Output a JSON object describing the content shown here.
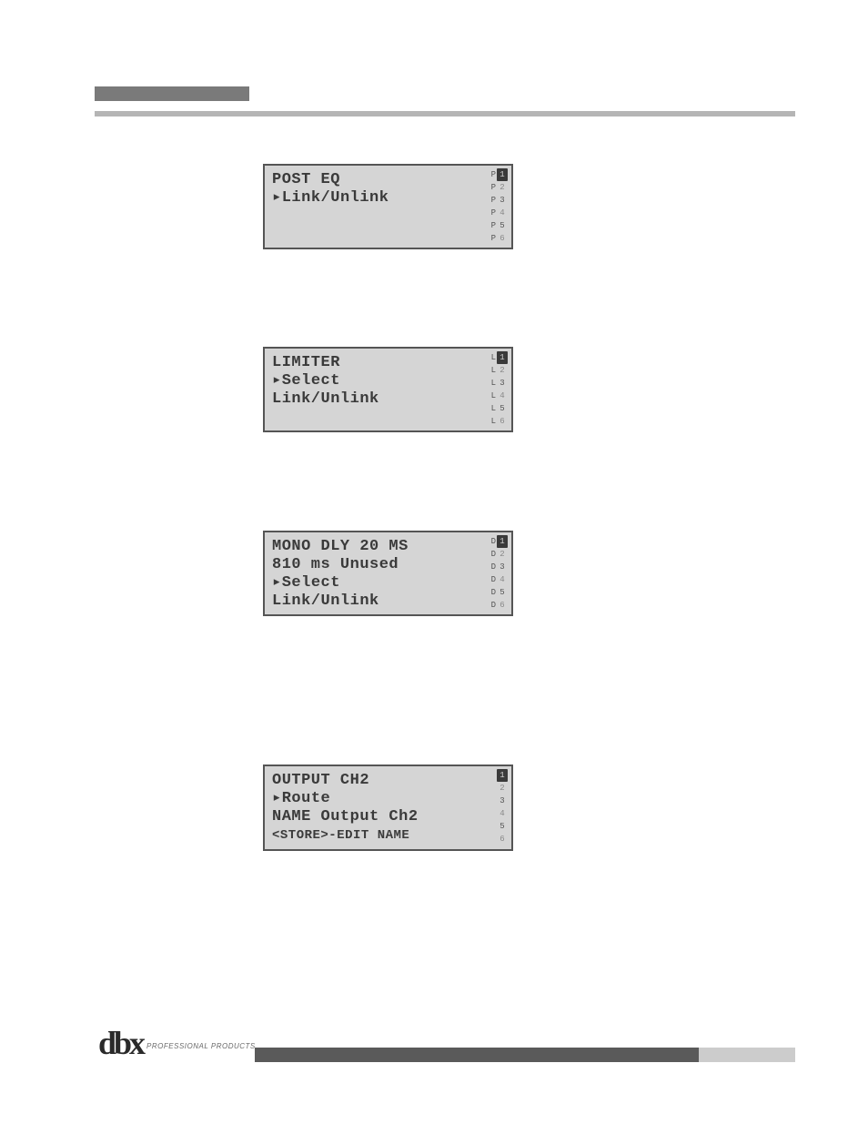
{
  "lcd1": {
    "title": "POST EQ",
    "line2": "",
    "line3": "",
    "line4": "▸Link/Unlink",
    "sidebar": [
      {
        "prefix": "P",
        "num": "1",
        "hl": true
      },
      {
        "prefix": "P",
        "num": "2",
        "dim": true
      },
      {
        "prefix": "P",
        "num": "3"
      },
      {
        "prefix": "P",
        "num": "4",
        "dim": true
      },
      {
        "prefix": "P",
        "num": "5"
      },
      {
        "prefix": "P",
        "num": "6",
        "dim": true
      }
    ]
  },
  "lcd2": {
    "title": "LIMITER",
    "line2": "",
    "line3": "▸Select",
    "line4": " Link/Unlink",
    "sidebar": [
      {
        "prefix": "L",
        "num": "1",
        "hl": true
      },
      {
        "prefix": "L",
        "num": "2",
        "dim": true
      },
      {
        "prefix": "L",
        "num": "3"
      },
      {
        "prefix": "L",
        "num": "4",
        "dim": true
      },
      {
        "prefix": "L",
        "num": "5"
      },
      {
        "prefix": "L",
        "num": "6",
        "dim": true
      }
    ]
  },
  "lcd3": {
    "title": "MONO DLY 20 MS",
    "line2": "810 ms Unused",
    "line3": "▸Select",
    "line4": " Link/Unlink",
    "sidebar": [
      {
        "prefix": "D",
        "num": "1",
        "hl": true
      },
      {
        "prefix": "D",
        "num": "2",
        "dim": true
      },
      {
        "prefix": "D",
        "num": "3"
      },
      {
        "prefix": "D",
        "num": "4",
        "dim": true
      },
      {
        "prefix": "D",
        "num": "5"
      },
      {
        "prefix": "D",
        "num": "6",
        "dim": true
      }
    ]
  },
  "lcd4": {
    "title": "OUTPUT CH2",
    "line2": "▸Route",
    "line3": "NAME Output Ch2",
    "line4": "<STORE>-EDIT NAME",
    "sidebar": [
      {
        "prefix": "",
        "num": "1",
        "hl": true
      },
      {
        "prefix": "",
        "num": "2",
        "dim": true
      },
      {
        "prefix": "",
        "num": "3"
      },
      {
        "prefix": "",
        "num": "4",
        "dim": true
      },
      {
        "prefix": "",
        "num": "5"
      },
      {
        "prefix": "",
        "num": "6",
        "dim": true
      }
    ]
  },
  "logo": {
    "brand": "dbx",
    "tagline": "PROFESSIONAL PRODUCTS"
  }
}
